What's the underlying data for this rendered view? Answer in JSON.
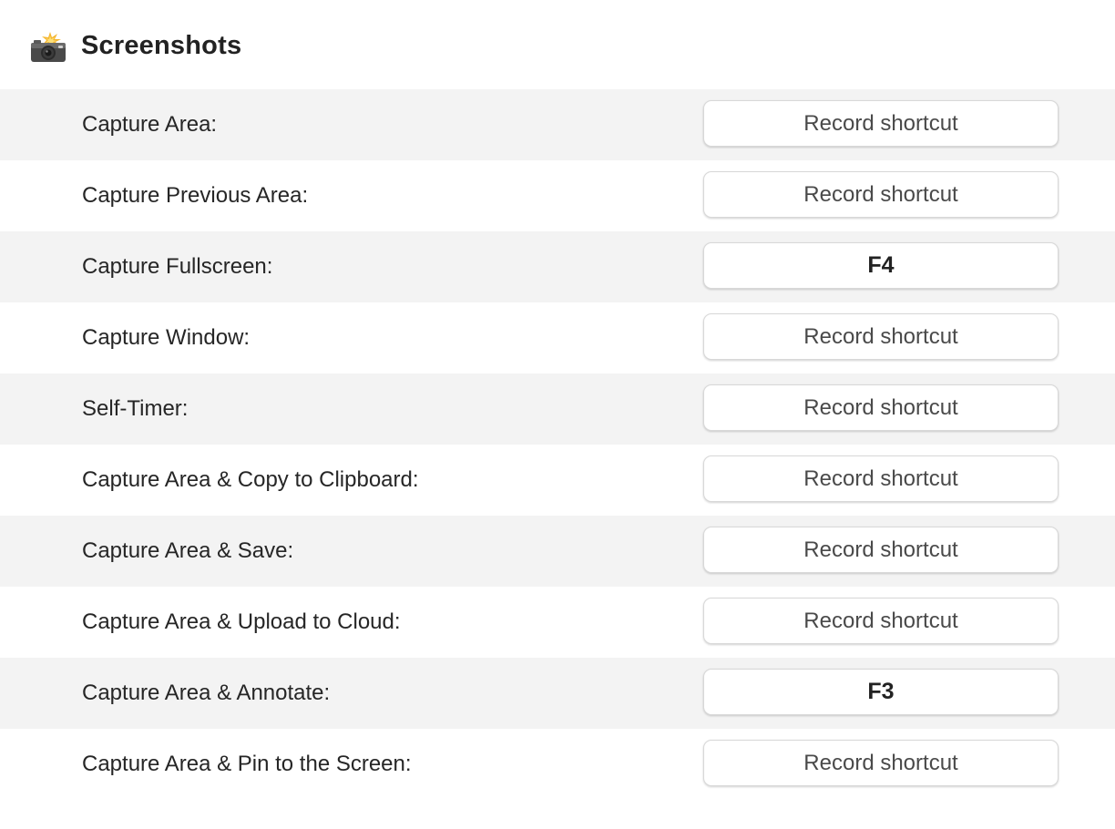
{
  "section": {
    "title": "Screenshots",
    "icon": "camera-flash-icon"
  },
  "shortcuts": [
    {
      "label": "Capture Area:",
      "value": "Record shortcut",
      "is_set": false
    },
    {
      "label": "Capture Previous Area:",
      "value": "Record shortcut",
      "is_set": false
    },
    {
      "label": "Capture Fullscreen:",
      "value": "F4",
      "is_set": true
    },
    {
      "label": "Capture Window:",
      "value": "Record shortcut",
      "is_set": false
    },
    {
      "label": "Self-Timer:",
      "value": "Record shortcut",
      "is_set": false
    },
    {
      "label": "Capture Area & Copy to Clipboard:",
      "value": "Record shortcut",
      "is_set": false
    },
    {
      "label": "Capture Area & Save:",
      "value": "Record shortcut",
      "is_set": false
    },
    {
      "label": "Capture Area & Upload to Cloud:",
      "value": "Record shortcut",
      "is_set": false
    },
    {
      "label": "Capture Area & Annotate:",
      "value": "F3",
      "is_set": true
    },
    {
      "label": "Capture Area & Pin to the Screen:",
      "value": "Record shortcut",
      "is_set": false
    }
  ],
  "colors": {
    "row_shaded": "#f3f3f3",
    "row_plain": "#ffffff",
    "button_border": "#d8d8d8"
  }
}
